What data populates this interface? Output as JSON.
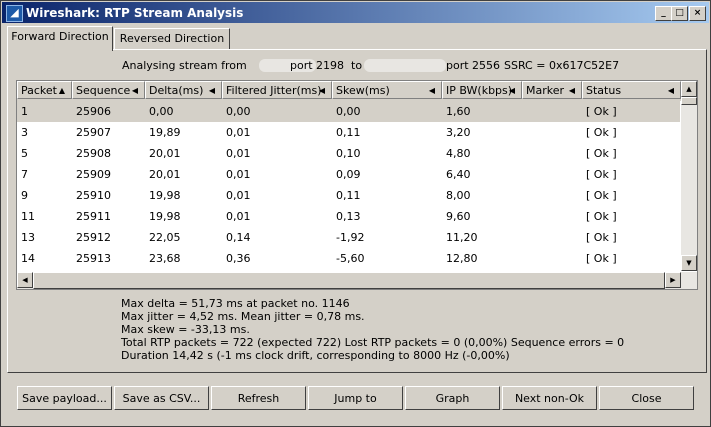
{
  "window": {
    "title": "Wireshark: RTP Stream Analysis",
    "minimize_glyph": "_",
    "maximize_glyph": "□",
    "close_glyph": "×"
  },
  "tabs": [
    {
      "label": "Forward Direction",
      "active": true
    },
    {
      "label": "Reversed Direction",
      "active": false
    }
  ],
  "analysis": {
    "prefix": "Analysing stream from",
    "port_from": "port 2198",
    "to": "to",
    "port_to": "port 2556",
    "ssrc": "SSRC = 0x617C52E7"
  },
  "table": {
    "columns": [
      "Packet",
      "Sequence",
      "Delta(ms)",
      "Filtered Jitter(ms)",
      "Skew(ms)",
      "IP BW(kbps)",
      "Marker",
      "Status"
    ],
    "sort_column": "Packet",
    "rows": [
      [
        "1",
        "25906",
        "0,00",
        "0,00",
        "0,00",
        "1,60",
        "",
        "[ Ok ]"
      ],
      [
        "3",
        "25907",
        "19,89",
        "0,01",
        "0,11",
        "3,20",
        "",
        "[ Ok ]"
      ],
      [
        "5",
        "25908",
        "20,01",
        "0,01",
        "0,10",
        "4,80",
        "",
        "[ Ok ]"
      ],
      [
        "7",
        "25909",
        "20,01",
        "0,01",
        "0,09",
        "6,40",
        "",
        "[ Ok ]"
      ],
      [
        "9",
        "25910",
        "19,98",
        "0,01",
        "0,11",
        "8,00",
        "",
        "[ Ok ]"
      ],
      [
        "11",
        "25911",
        "19,98",
        "0,01",
        "0,13",
        "9,60",
        "",
        "[ Ok ]"
      ],
      [
        "13",
        "25912",
        "22,05",
        "0,14",
        "-1,92",
        "11,20",
        "",
        "[ Ok ]"
      ],
      [
        "14",
        "25913",
        "23,68",
        "0,36",
        "-5,60",
        "12,80",
        "",
        "[ Ok ]"
      ]
    ],
    "selected_row": 0
  },
  "stats": [
    "Max delta = 51,73 ms at packet no. 1146",
    "Max jitter = 4,52 ms. Mean jitter = 0,78 ms.",
    "Max skew = -33,13 ms.",
    "Total RTP packets = 722   (expected 722)   Lost RTP packets = 0 (0,00%)   Sequence errors = 0",
    "Duration 14,42 s (-1 ms clock drift, corresponding to 8000 Hz (-0,00%)"
  ],
  "buttons": {
    "save_payload": "Save payload...",
    "save_csv": "Save as CSV...",
    "refresh": "Refresh",
    "jump_to": "Jump to",
    "graph": "Graph",
    "next_non_ok": "Next non-Ok",
    "close": "Close"
  }
}
